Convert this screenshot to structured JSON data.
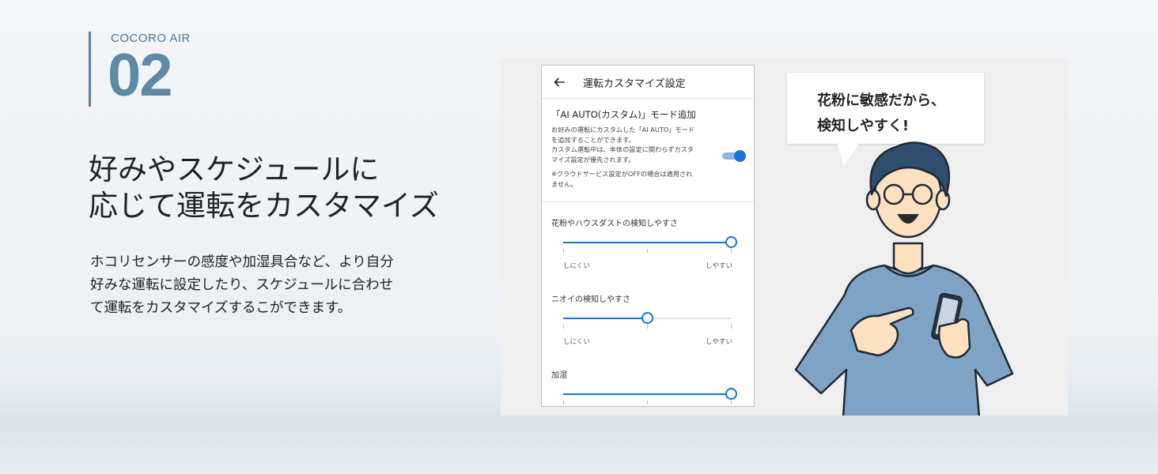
{
  "brand": {
    "name": "COCORO AIR",
    "number": "02"
  },
  "headline": {
    "line1": "好みやスケジュールに",
    "line2": "応じて運転をカスタマイズ"
  },
  "description": {
    "line1": "ホコリセンサーの感度や加湿具合など、より自分",
    "line2": "好みな運転に設定したり、スケジュールに合わせ",
    "line3": "て運転をカスタマイズするこができます。"
  },
  "phone": {
    "title": "運転カスタマイズ設定",
    "mode": {
      "title": "「AI AUTO(カスタム)」モード追加",
      "desc": [
        "お好みの運転にカスタムした「AI AUTO」モード",
        "を追加することができます。",
        "カスタム運転中は、本体の設定に関わらずカスタ",
        "マイズ設定が優先されます。"
      ],
      "note": [
        "※クラウドサービス設定がOFFの場合は適用され",
        "ません。"
      ],
      "toggle_on": true
    },
    "sliders": [
      {
        "label": "花粉やハウスダストの検知しやすさ",
        "min_label": "しにくい",
        "max_label": "しやすい",
        "value": 1.0
      },
      {
        "label": "ニオイの検知しやすさ",
        "min_label": "しにくい",
        "max_label": "しやすい",
        "value": 0.5
      },
      {
        "label": "加湿",
        "min_label": "",
        "max_label": "",
        "value": 1.0
      }
    ],
    "accent_color": "#1a73d6"
  },
  "bubble": {
    "line1": "花粉に敏感だから、",
    "line2": "検知しやすく!"
  },
  "colors": {
    "brand": "#5e8aa6",
    "shirt": "#7fa3c4",
    "hair": "#2f4e6e"
  }
}
